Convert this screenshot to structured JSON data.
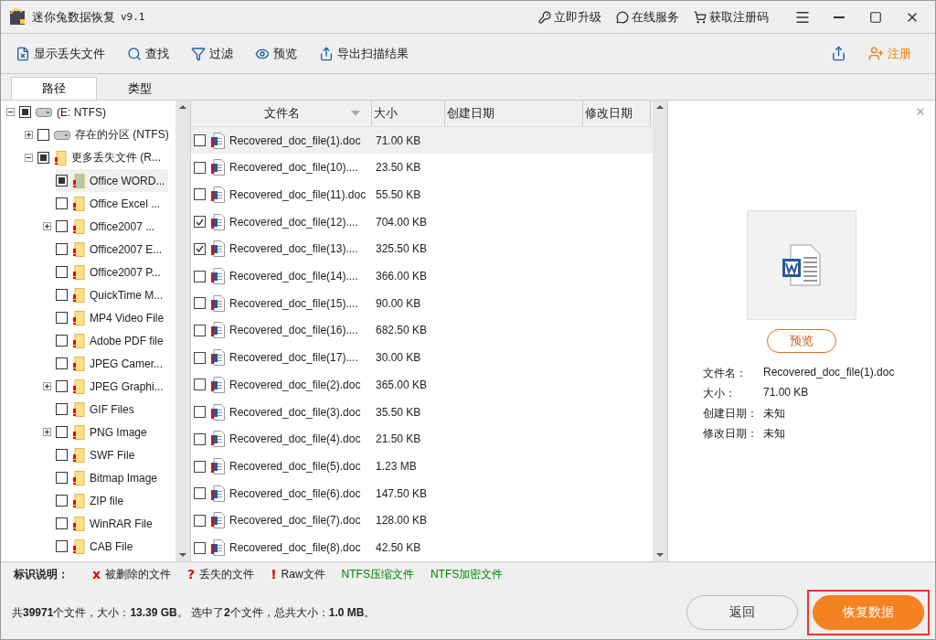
{
  "window": {
    "title": "迷你兔数据恢复",
    "version": "v9.1",
    "links": [
      {
        "kind": "upgrade",
        "label": "立即升级"
      },
      {
        "kind": "service",
        "label": "在线服务"
      },
      {
        "kind": "cart",
        "label": "获取注册码"
      }
    ]
  },
  "toolbar": [
    {
      "kind": "lost",
      "label": "显示丢失文件"
    },
    {
      "kind": "search",
      "label": "查找"
    },
    {
      "kind": "filter",
      "label": "过滤"
    },
    {
      "kind": "preview",
      "label": "预览"
    },
    {
      "kind": "export",
      "label": "导出扫描结果"
    }
  ],
  "register": "注册",
  "tabs": [
    {
      "label": "路径",
      "selected": true
    },
    {
      "label": "类型",
      "selected": false
    }
  ],
  "tree": [
    {
      "label": "(E: NTFS)",
      "kind": "drive",
      "checked": false,
      "partial": true,
      "expanded": true,
      "children": [
        {
          "label": "存在的分区 (NTFS)",
          "kind": "drive",
          "checked": false,
          "partial": false,
          "expanded": false
        },
        {
          "label": "更多丢失文件 (R...",
          "kind": "folder",
          "checked": false,
          "partial": true,
          "expanded": true,
          "children": [
            {
              "label": "Office WORD...",
              "kind": "folder",
              "checked": false,
              "partial": true,
              "selected": true
            },
            {
              "label": "Office Excel ...",
              "kind": "folder",
              "checked": false,
              "partial": false,
              "selected": false
            },
            {
              "label": "Office2007 ...",
              "kind": "folder",
              "checked": false,
              "partial": false,
              "selected": false,
              "expanded": false
            },
            {
              "label": "Office2007 E...",
              "kind": "folder",
              "checked": false,
              "partial": false,
              "selected": false
            },
            {
              "label": "Office2007 P...",
              "kind": "folder",
              "checked": false,
              "partial": false,
              "selected": false
            },
            {
              "label": "QuickTime M...",
              "kind": "folder",
              "checked": false,
              "partial": false,
              "selected": false
            },
            {
              "label": "MP4 Video File",
              "kind": "folder",
              "checked": false,
              "partial": false,
              "selected": false
            },
            {
              "label": "Adobe PDF file",
              "kind": "folder",
              "checked": false,
              "partial": false,
              "selected": false
            },
            {
              "label": "JPEG Camer...",
              "kind": "folder",
              "checked": false,
              "partial": false,
              "selected": false
            },
            {
              "label": "JPEG Graphi...",
              "kind": "folder",
              "checked": false,
              "partial": false,
              "selected": false,
              "expanded": false
            },
            {
              "label": "GIF Files",
              "kind": "folder",
              "checked": false,
              "partial": false,
              "selected": false
            },
            {
              "label": "PNG Image",
              "kind": "folder",
              "checked": false,
              "partial": false,
              "selected": false,
              "expanded": false
            },
            {
              "label": "SWF File",
              "kind": "folder",
              "checked": false,
              "partial": false,
              "selected": false
            },
            {
              "label": "Bitmap Image",
              "kind": "folder",
              "checked": false,
              "partial": false,
              "selected": false
            },
            {
              "label": "ZIP file",
              "kind": "folder",
              "checked": false,
              "partial": false,
              "selected": false
            },
            {
              "label": "WinRAR File",
              "kind": "folder",
              "checked": false,
              "partial": false,
              "selected": false
            },
            {
              "label": "CAB File",
              "kind": "folder",
              "checked": false,
              "partial": false,
              "selected": false
            }
          ]
        }
      ]
    }
  ],
  "table": {
    "columns": [
      "文件名",
      "大小",
      "创建日期",
      "修改日期"
    ],
    "rows": [
      {
        "name": "Recovered_doc_file(1).doc",
        "size": "71.00 KB",
        "checked": false,
        "selected": true
      },
      {
        "name": "Recovered_doc_file(10)....",
        "size": "23.50 KB",
        "checked": false,
        "selected": false
      },
      {
        "name": "Recovered_doc_file(11).doc",
        "size": "55.50 KB",
        "checked": false,
        "selected": false
      },
      {
        "name": "Recovered_doc_file(12)....",
        "size": "704.00 KB",
        "checked": true,
        "selected": false
      },
      {
        "name": "Recovered_doc_file(13)....",
        "size": "325.50 KB",
        "checked": true,
        "selected": false
      },
      {
        "name": "Recovered_doc_file(14)....",
        "size": "366.00 KB",
        "checked": false,
        "selected": false
      },
      {
        "name": "Recovered_doc_file(15)....",
        "size": "90.00 KB",
        "checked": false,
        "selected": false
      },
      {
        "name": "Recovered_doc_file(16)....",
        "size": "682.50 KB",
        "checked": false,
        "selected": false
      },
      {
        "name": "Recovered_doc_file(17)....",
        "size": "30.00 KB",
        "checked": false,
        "selected": false
      },
      {
        "name": "Recovered_doc_file(2).doc",
        "size": "365.00 KB",
        "checked": false,
        "selected": false
      },
      {
        "name": "Recovered_doc_file(3).doc",
        "size": "35.50 KB",
        "checked": false,
        "selected": false
      },
      {
        "name": "Recovered_doc_file(4).doc",
        "size": "21.50 KB",
        "checked": false,
        "selected": false
      },
      {
        "name": "Recovered_doc_file(5).doc",
        "size": "1.23 MB",
        "checked": false,
        "selected": false
      },
      {
        "name": "Recovered_doc_file(6).doc",
        "size": "147.50 KB",
        "checked": false,
        "selected": false
      },
      {
        "name": "Recovered_doc_file(7).doc",
        "size": "128.00 KB",
        "checked": false,
        "selected": false
      },
      {
        "name": "Recovered_doc_file(8).doc",
        "size": "42.50 KB",
        "checked": false,
        "selected": false
      }
    ]
  },
  "preview": {
    "button": "预览",
    "info": [
      {
        "label": "文件名：",
        "value": "Recovered_doc_file(1).doc"
      },
      {
        "label": "大小：",
        "value": "71.00 KB"
      },
      {
        "label": "创建日期：",
        "value": "未知"
      },
      {
        "label": "修改日期：",
        "value": "未知"
      }
    ]
  },
  "legend": {
    "title": "标识说明：",
    "items": [
      {
        "mark": "x",
        "label": "被删除的文件",
        "color": "#e00000"
      },
      {
        "mark": "?",
        "label": "丢失的文件",
        "color": "#e00000"
      },
      {
        "mark": "!",
        "label": "Raw文件",
        "color": "#e00000"
      },
      {
        "label": "NTFS压缩文件",
        "color": "#008000"
      },
      {
        "label": "NTFS加密文件",
        "color": "#008000"
      }
    ]
  },
  "status": "共**39971**个文件，大小：**13.39 GB**。 选中了**2**个文件，总共大小：**1.0 MB**。",
  "buttons": [
    {
      "kind": "back",
      "label": "返回"
    },
    {
      "kind": "primary",
      "label": "恢复数据"
    }
  ]
}
